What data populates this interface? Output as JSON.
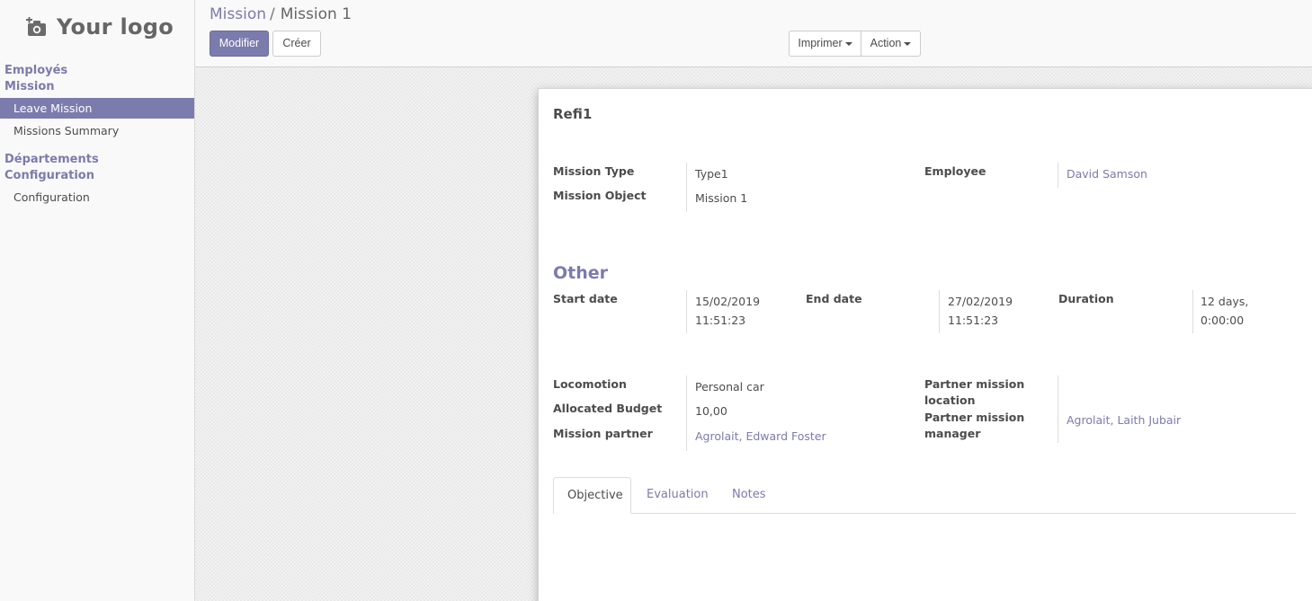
{
  "sidebar": {
    "logo_text": "Your logo",
    "sections": [
      {
        "title_lines": [
          "Employés",
          "Mission"
        ],
        "items": [
          {
            "label": "Leave Mission",
            "active": true
          },
          {
            "label": "Missions Summary",
            "active": false
          }
        ]
      },
      {
        "title_lines": [
          "Départements",
          "Configuration"
        ],
        "items": [
          {
            "label": "Configuration",
            "active": false
          }
        ]
      }
    ]
  },
  "breadcrumb": {
    "parent": "Mission",
    "separator": "/",
    "current": "Mission 1"
  },
  "toolbar": {
    "edit_label": "Modifier",
    "create_label": "Créer",
    "print_label": "Imprimer",
    "action_label": "Action"
  },
  "record": {
    "name": "Refi1",
    "mission_type": {
      "label": "Mission Type",
      "value": "Type1"
    },
    "mission_object": {
      "label": "Mission Object",
      "value": "Mission 1"
    },
    "employee": {
      "label": "Employee",
      "value": "David Samson"
    },
    "other_title": "Other",
    "start_date": {
      "label": "Start date",
      "value_line1": "15/02/2019",
      "value_line2": "11:51:23"
    },
    "end_date": {
      "label": "End date",
      "value_line1": "27/02/2019",
      "value_line2": "11:51:23"
    },
    "duration": {
      "label": "Duration",
      "value_line1": "12 days,",
      "value_line2": "0:00:00"
    },
    "locomotion": {
      "label": "Locomotion",
      "value": "Personal car"
    },
    "allocated_budget": {
      "label": "Allocated Budget",
      "value": "10,00"
    },
    "mission_partner": {
      "label": "Mission partner",
      "value": "Agrolait, Edward Foster"
    },
    "partner_mission_location": {
      "label_line1": "Partner mission",
      "label_line2": "location",
      "value": ""
    },
    "partner_mission_manager": {
      "label_line1": "Partner mission",
      "label_line2": "manager",
      "value": "Agrolait, Laith Jubair"
    }
  },
  "tabs": [
    {
      "label": "Objective",
      "active": true
    },
    {
      "label": "Evaluation",
      "active": false
    },
    {
      "label": "Notes",
      "active": false
    }
  ],
  "colors": {
    "brand": "#7c7bad",
    "text": "#4c4c4c",
    "panel_bg": "#f9f9f9"
  }
}
